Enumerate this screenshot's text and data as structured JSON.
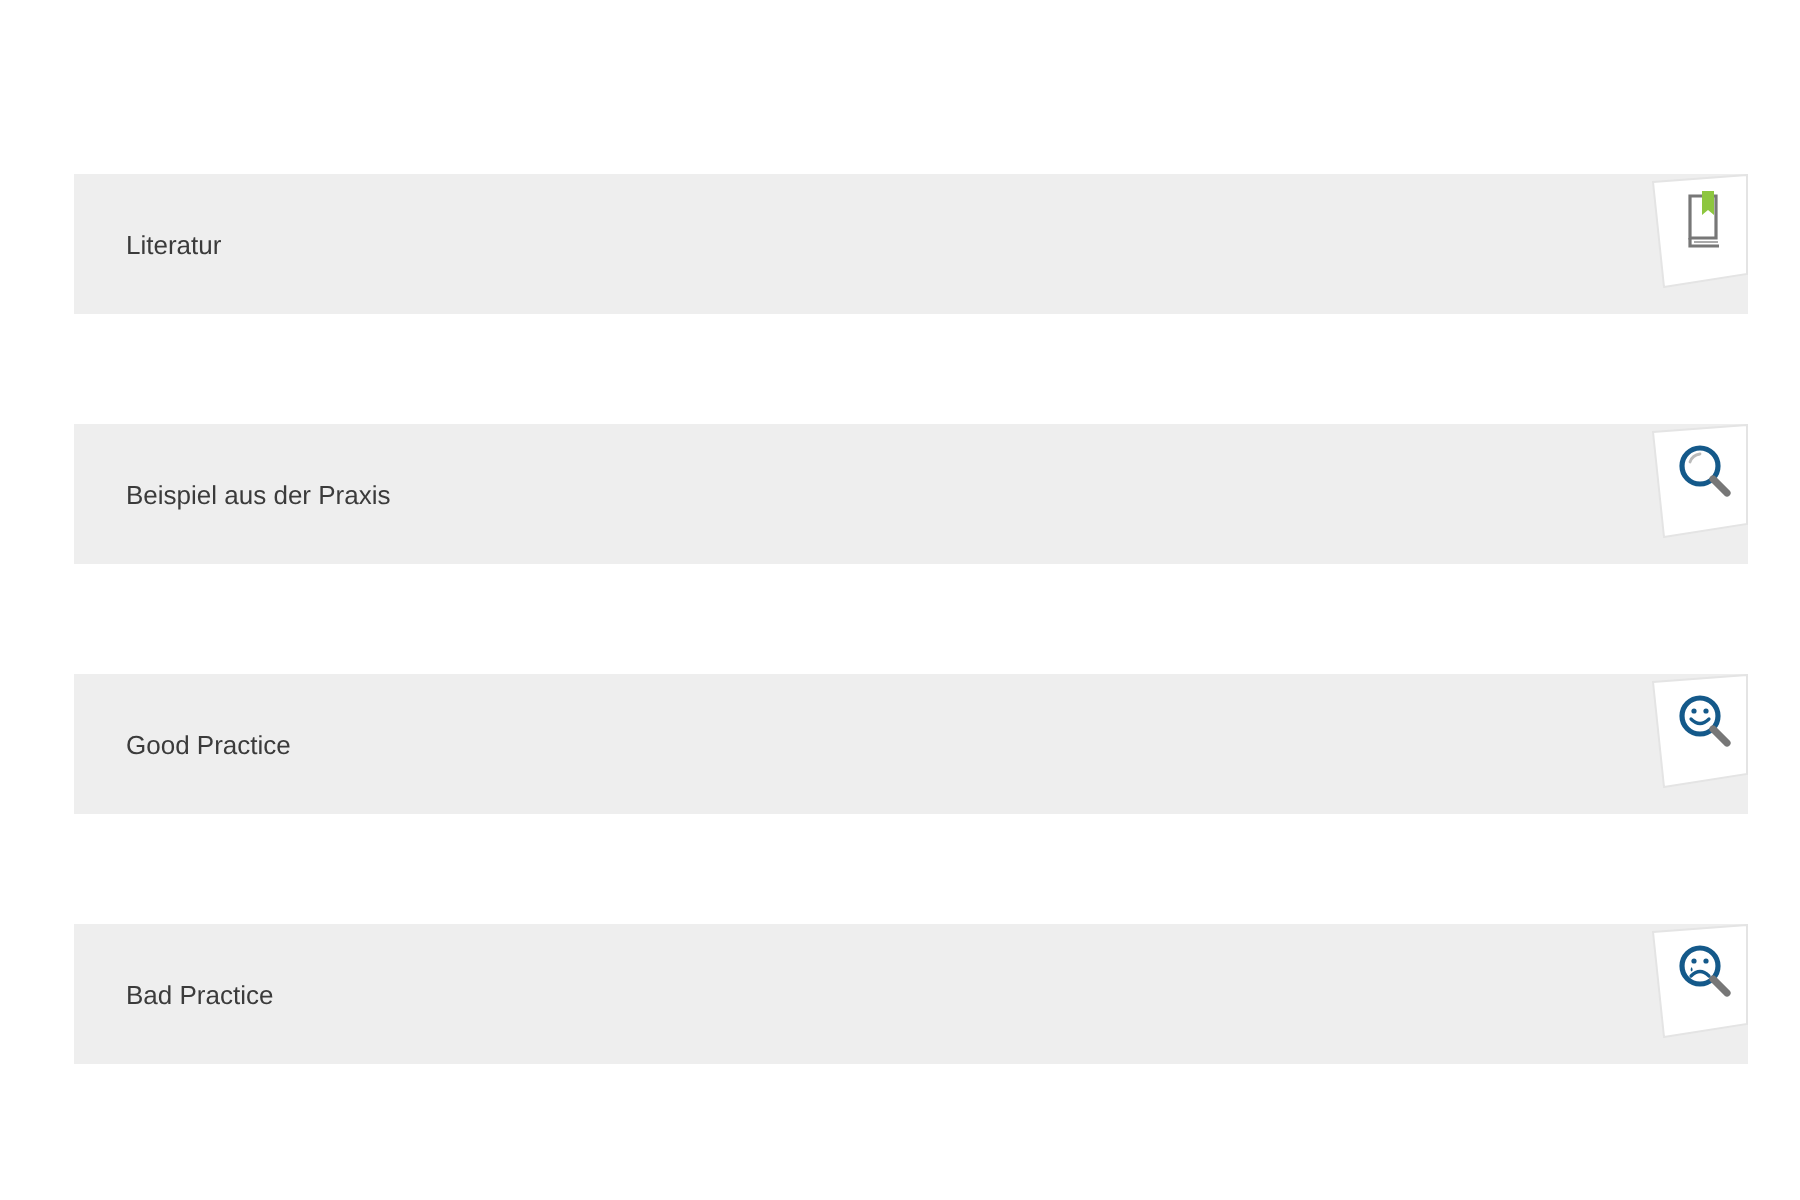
{
  "items": [
    {
      "label": "Literatur",
      "kind": "book"
    },
    {
      "label": "Beispiel aus der Praxis",
      "kind": "search"
    },
    {
      "label": "Good Practice",
      "kind": "happy"
    },
    {
      "label": "Bad Practice",
      "kind": "sad"
    }
  ]
}
